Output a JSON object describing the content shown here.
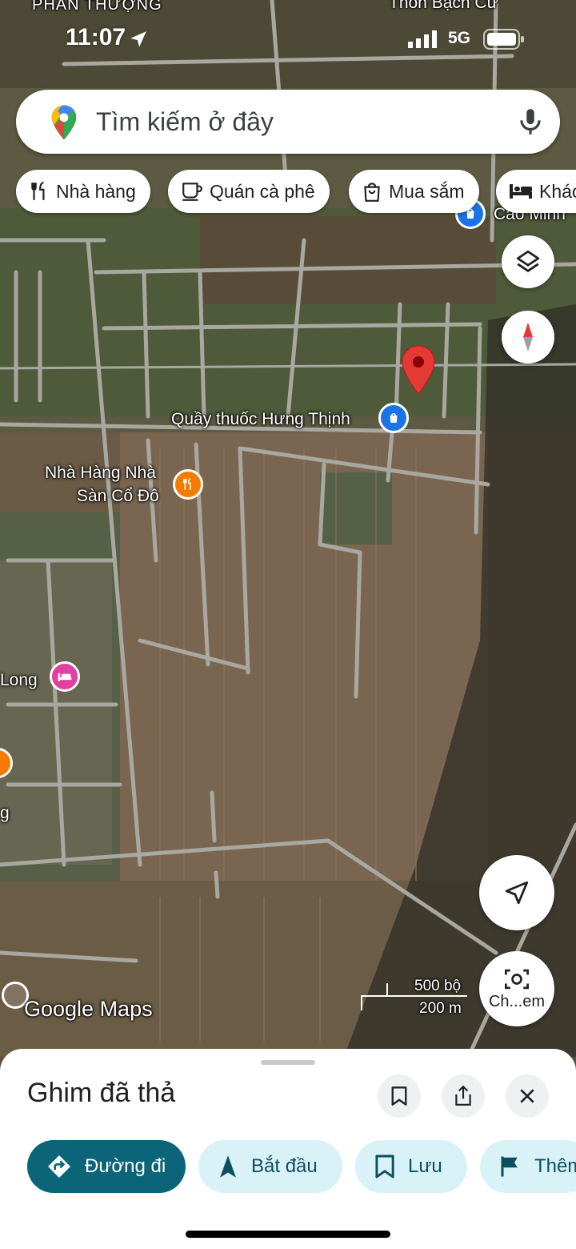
{
  "status_bar": {
    "time": "11:07",
    "network": "5G"
  },
  "search": {
    "placeholder": "Tìm kiếm ở đây"
  },
  "chips": [
    {
      "label": "Nhà hàng",
      "icon": "fork-knife-icon"
    },
    {
      "label": "Quán cà phê",
      "icon": "coffee-cup-icon"
    },
    {
      "label": "Mua sắm",
      "icon": "shopping-bag-icon"
    },
    {
      "label": "Khác",
      "icon": "bed-icon"
    }
  ],
  "map": {
    "place_labels": {
      "top_left": "PHAN THƯỢNG",
      "top_right": "Thôn Bạch Cừ",
      "cao_minh": "Cao Minh",
      "pharmacy": "Quầy thuốc Hưng Thịnh",
      "restaurant_line1": "Nhà Hàng Nhà",
      "restaurant_line2": "Sàn Cổ Đô",
      "hotel": "Long",
      "left_edge": "g"
    },
    "scale": {
      "imperial": "500 bộ",
      "metric": "200 m"
    },
    "attribution": "Google Maps"
  },
  "controls": {
    "streetview_label": "Ch...em"
  },
  "colors": {
    "accent": "#0b6477",
    "pin": "#e53935",
    "restaurant_poi": "#f57c00",
    "shop_poi": "#1a73e8",
    "hotel_poi": "#e040a0"
  },
  "sheet": {
    "title": "Ghim đã thả",
    "actions": {
      "directions": "Đường đi",
      "start": "Bắt đầu",
      "save": "Lưu",
      "more": "Thêm"
    }
  }
}
